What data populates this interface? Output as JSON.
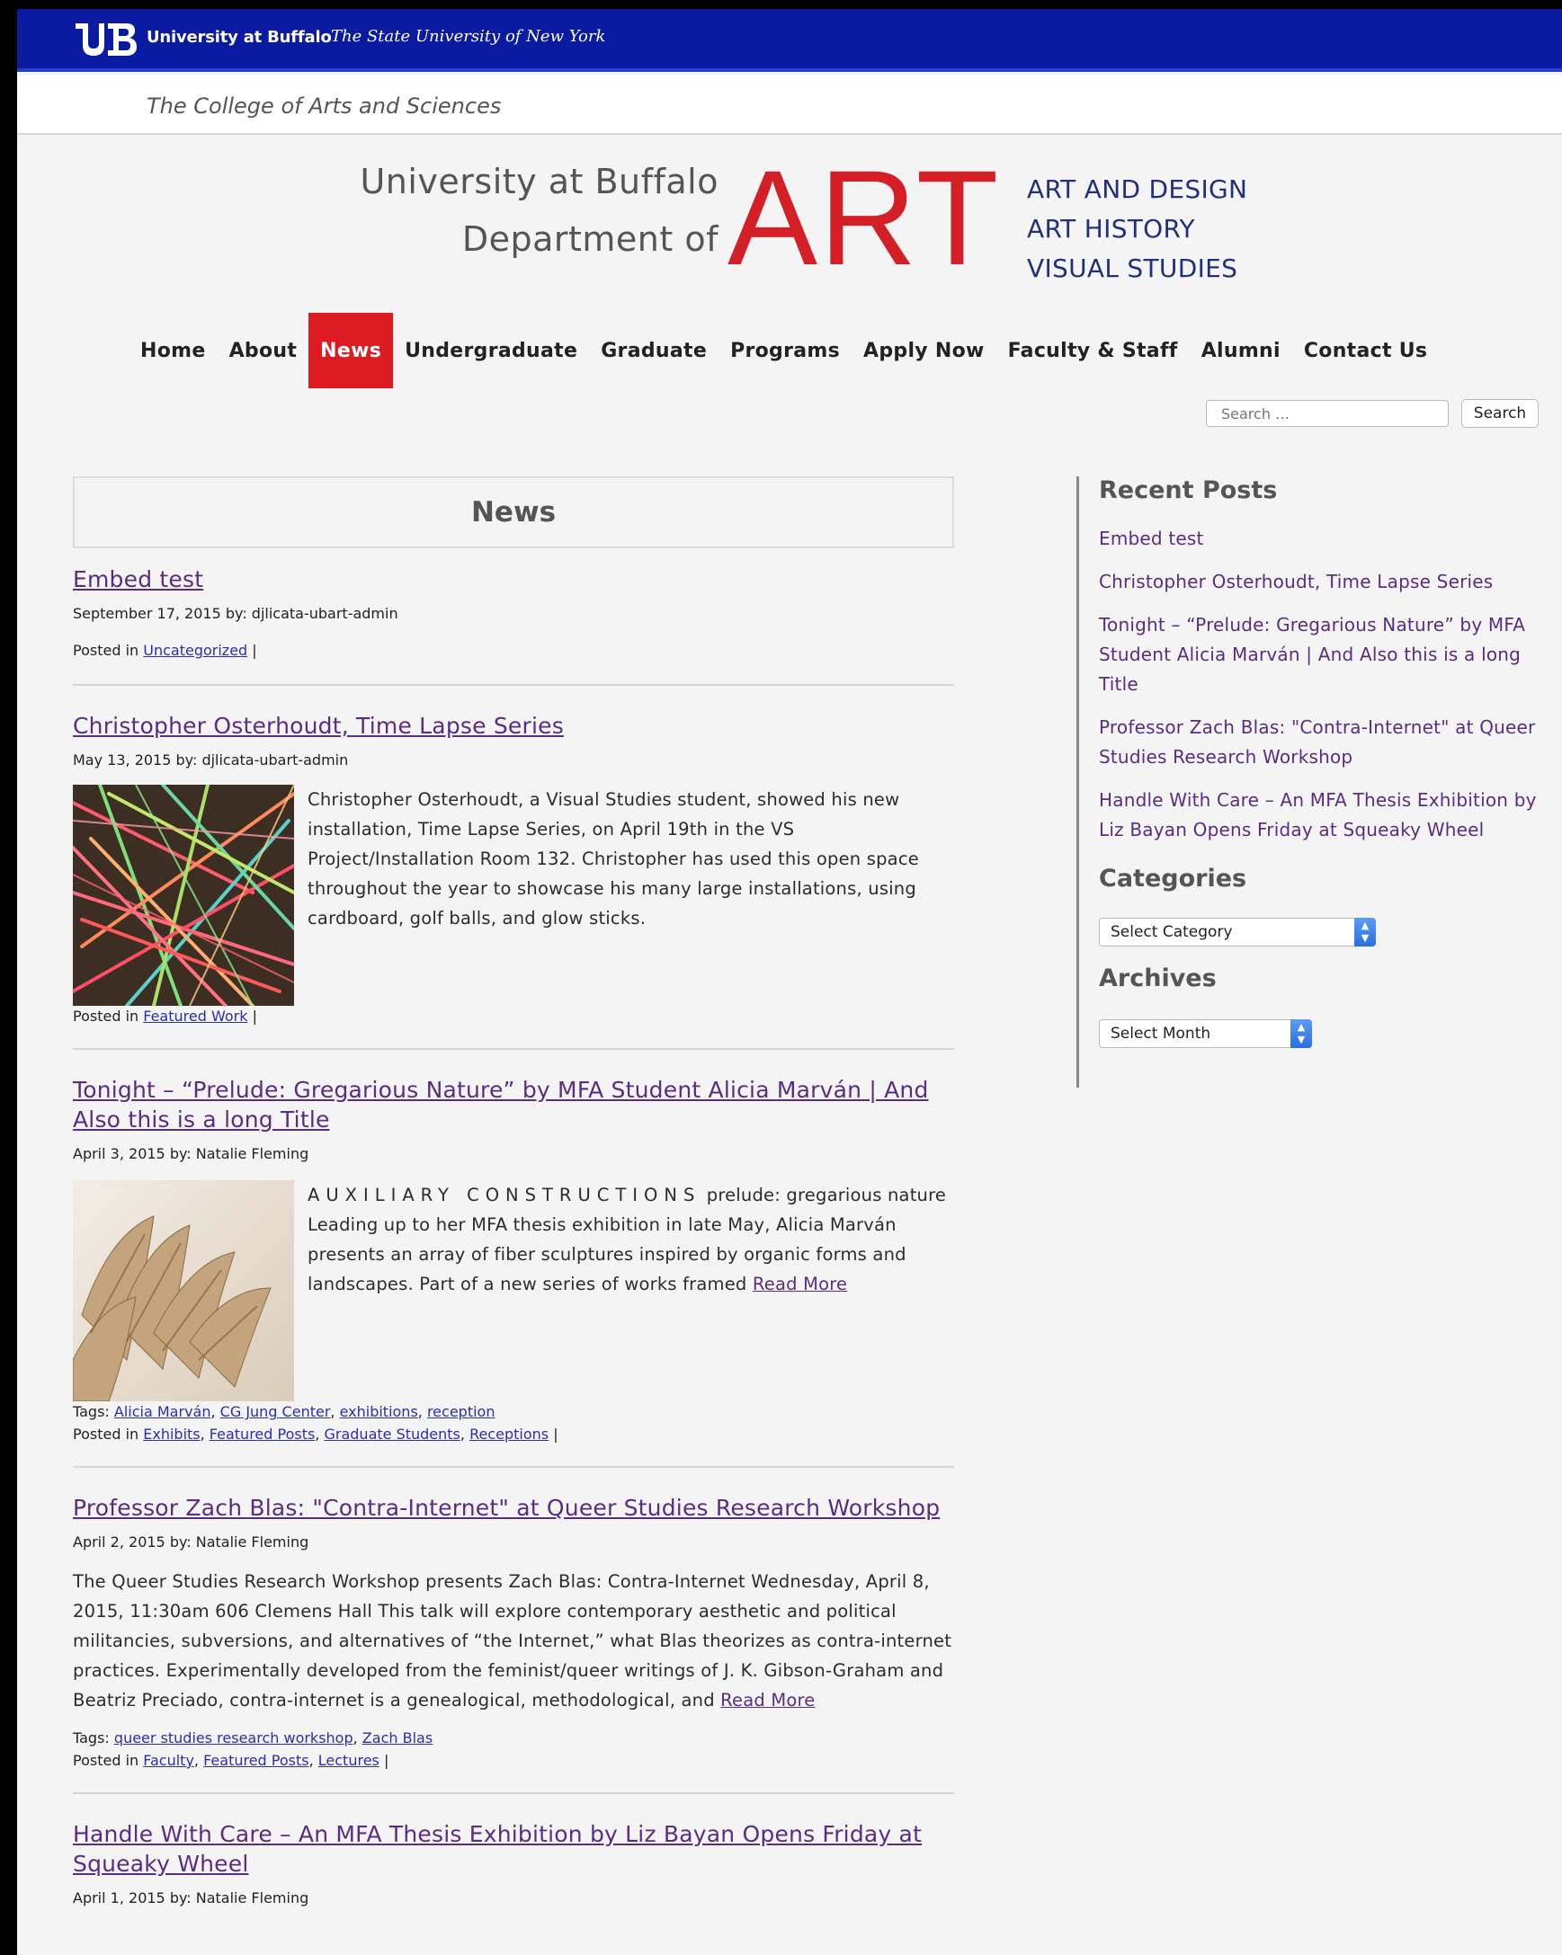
{
  "topbar": {
    "ub_name": "University at Buffalo",
    "ub_tagline": "The State University of New York"
  },
  "college": "The College of Arts and Sciences",
  "masthead": {
    "line1": "University at Buffalo",
    "line2": "Department of",
    "art": "ART",
    "programs": [
      "ART AND DESIGN",
      "ART HISTORY",
      "VISUAL STUDIES"
    ]
  },
  "nav": {
    "items": [
      "Home",
      "About",
      "News",
      "Undergraduate",
      "Graduate",
      "Programs",
      "Apply Now",
      "Faculty & Staff",
      "Alumni",
      "Contact Us"
    ],
    "active": "News"
  },
  "search": {
    "placeholder": "Search …",
    "button": "Search"
  },
  "main": {
    "heading": "News",
    "posts": [
      {
        "title": "Embed test",
        "meta": "September 17, 2015  by: djlicata-ubart-admin",
        "posted_in_label": "Posted in",
        "categories": [
          "Uncategorized"
        ],
        "sep": "|"
      },
      {
        "title": "Christopher Osterhoudt, Time Lapse Series",
        "meta": "May 13, 2015  by: djlicata-ubart-admin",
        "excerpt": "Christopher Osterhoudt, a Visual Studies student, showed his new installation, Time Lapse Series, on April 19th in the VS Project/Installation Room 132. Christopher has used this open space throughout the year to showcase his many large installations, using cardboard, golf balls, and glow sticks.",
        "posted_in_label": "Posted in",
        "categories": [
          "Featured Work"
        ],
        "sep": "|"
      },
      {
        "title": "Tonight – “Prelude: Gregarious Nature” by MFA Student Alicia Marván | And Also this is a long Title",
        "meta": "April 3, 2015  by: Natalie Fleming",
        "excerpt_lead": "AUXILIARY CONSTRUCTIONS",
        "excerpt": " prelude: gregarious nature Leading up to her MFA thesis exhibition in late May, Alicia Marván presents an array of fiber sculptures inspired by organic forms and landscapes. Part of a new series of works framed ",
        "read_more": "Read More",
        "tags_label": "Tags:",
        "tags": [
          "Alicia Marván",
          "CG Jung Center",
          "exhibitions",
          "reception"
        ],
        "posted_in_label": "Posted in",
        "categories": [
          "Exhibits",
          "Featured Posts",
          "Graduate Students",
          "Receptions"
        ],
        "sep": "|"
      },
      {
        "title": "Professor Zach Blas: \"Contra-Internet\" at Queer Studies Research Workshop",
        "meta": "April 2, 2015  by: Natalie Fleming",
        "excerpt": "The Queer Studies Research Workshop presents Zach Blas: Contra-Internet Wednesday, April 8, 2015, 11:30am 606 Clemens Hall This talk will explore contemporary aesthetic and political militancies, subversions, and alternatives of “the Internet,” what Blas theorizes as contra-internet practices. Experimentally developed from the feminist/queer writings of J. K. Gibson-Graham and Beatriz Preciado, contra-internet is a genealogical, methodological, and ",
        "read_more": "Read More",
        "tags_label": "Tags:",
        "tags": [
          "queer studies research workshop",
          "Zach Blas"
        ],
        "posted_in_label": "Posted in",
        "categories": [
          "Faculty",
          "Featured Posts",
          "Lectures"
        ],
        "sep": "|"
      },
      {
        "title": "Handle With Care – An MFA Thesis Exhibition by Liz Bayan Opens Friday at Squeaky Wheel",
        "meta": "April 1, 2015  by: Natalie Fleming"
      }
    ]
  },
  "sidebar": {
    "recent_title": "Recent Posts",
    "recent": [
      "Embed test",
      "Christopher Osterhoudt, Time Lapse Series",
      "Tonight – “Prelude: Gregarious Nature” by MFA Student Alicia Marván | And Also this is a long Title",
      "Professor Zach Blas: \"Contra-Internet\" at Queer Studies Research Workshop",
      "Handle With Care – An MFA Thesis Exhibition by Liz Bayan Opens Friday at Squeaky Wheel"
    ],
    "categories_title": "Categories",
    "categories_select": "Select Category",
    "archives_title": "Archives",
    "archives_select": "Select Month"
  },
  "colors": {
    "ub_blue": "#0a1aa1",
    "art_red": "#d41f26",
    "nav_active": "#dd1c22",
    "link_purple": "#5a2d82",
    "link_blue": "#2a2fb0"
  }
}
